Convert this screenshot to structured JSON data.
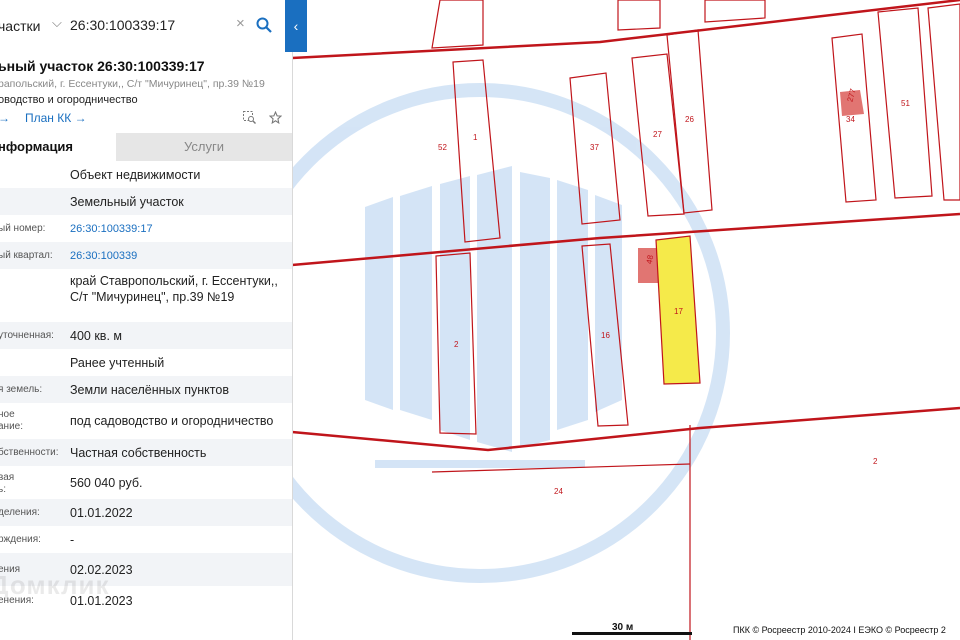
{
  "search": {
    "category": "частки",
    "query": "26:30:100339:17",
    "clear_symbol": "×",
    "collapse_symbol": "‹"
  },
  "card": {
    "title": "ьный участок 26:30:100339:17",
    "address": "рапольский, г. Ессентуки,, С/т \"Мичуринец\", пр.39 №19",
    "use": "оводство и огородничество",
    "link_arrow": "→",
    "plan_link": "План КК →"
  },
  "tabs": {
    "info": "нформация",
    "services": "Услуги"
  },
  "rows": [
    {
      "label": "",
      "value": "Объект недвижимости"
    },
    {
      "label": "",
      "value": "Земельный участок"
    },
    {
      "label": "ый номер:",
      "value": "26:30:100339:17"
    },
    {
      "label": "ый квартал:",
      "value": "26:30:100339"
    },
    {
      "label": "",
      "value": "край Ставропольский, г. Ессентуки,, С/т \"Мичуринец\", пр.39 №19"
    },
    {
      "label": "уточненная:",
      "value": "400 кв. м"
    },
    {
      "label": "",
      "value": "Ранее учтенный"
    },
    {
      "label": "я земель:",
      "value": "Земли населённых пунктов"
    },
    {
      "label": "ное\nание:",
      "value": "под садоводство и огородничество"
    },
    {
      "label": "бственности:",
      "value": "Частная собственность"
    },
    {
      "label": "вая\nь:",
      "value": "560 040 руб."
    },
    {
      "label": "деления:",
      "value": "01.01.2022"
    },
    {
      "label": "рждения:",
      "value": "-"
    },
    {
      "label": "ения",
      "value": "02.02.2023"
    },
    {
      "label": "енения:",
      "value": "01.01.2023"
    }
  ],
  "watermark": "Домклик",
  "map": {
    "scale_label": "30 м",
    "copyright": "ПКК © Росреестр 2010-2024 I ЕЭКО © Росреестр 2",
    "parcel_labels": [
      "52",
      "1",
      "37",
      "27",
      "26",
      "34",
      "277",
      "51",
      "2",
      "16",
      "17",
      "48",
      "2",
      "24"
    ],
    "colors": {
      "boundary": "#c0151b",
      "highlight": "#f5ea4a",
      "building": "#d9534f",
      "accent": "#1a6fc0"
    }
  }
}
